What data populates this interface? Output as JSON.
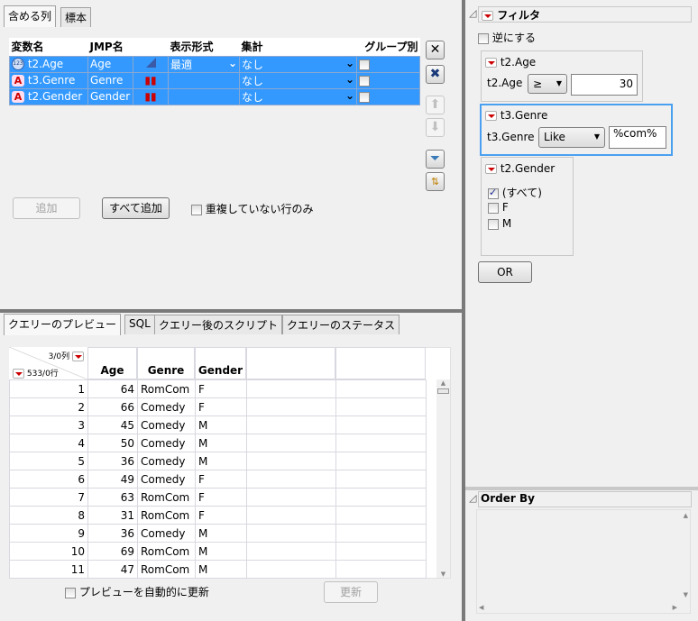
{
  "top_tabs": [
    "含める列",
    "標本"
  ],
  "columns_table": {
    "headers": [
      "変数名",
      "JMP名",
      "",
      "表示形式",
      "集計",
      "グループ別"
    ],
    "rows": [
      {
        "name": "t2.Age",
        "jmp": "Age",
        "type_icon": "numeric-icon",
        "model_icon": "continuous-icon",
        "format": "最適",
        "agg": "なし"
      },
      {
        "name": "t3.Genre",
        "jmp": "Genre",
        "type_icon": "character-icon",
        "model_icon": "nominal-icon",
        "format": "",
        "agg": "なし"
      },
      {
        "name": "t2.Gender",
        "jmp": "Gender",
        "type_icon": "character-icon",
        "model_icon": "nominal-icon",
        "format": "",
        "agg": "なし"
      }
    ]
  },
  "buttons": {
    "add": "追加",
    "add_all": "すべて追加",
    "distinct_only": "重複していない行のみ",
    "refresh": "更新",
    "auto_refresh": "プレビューを自動的に更新",
    "or": "OR"
  },
  "bottom_tabs": [
    "クエリーのプレビュー",
    "SQL",
    "クエリー後のスクリプト",
    "クエリーのステータス"
  ],
  "preview": {
    "cols_count": "3/0列",
    "rows_count": "533/0行",
    "headers": [
      "Age",
      "Genre",
      "Gender"
    ],
    "rows": [
      [
        1,
        64,
        "RomCom",
        "F"
      ],
      [
        2,
        66,
        "Comedy",
        "F"
      ],
      [
        3,
        45,
        "Comedy",
        "M"
      ],
      [
        4,
        50,
        "Comedy",
        "M"
      ],
      [
        5,
        36,
        "Comedy",
        "M"
      ],
      [
        6,
        49,
        "Comedy",
        "F"
      ],
      [
        7,
        63,
        "RomCom",
        "F"
      ],
      [
        8,
        31,
        "RomCom",
        "F"
      ],
      [
        9,
        36,
        "Comedy",
        "M"
      ],
      [
        10,
        69,
        "RomCom",
        "M"
      ],
      [
        11,
        47,
        "RomCom",
        "M"
      ]
    ]
  },
  "filter": {
    "title": "フィルタ",
    "invert": "逆にする",
    "age": {
      "title": "t2.Age",
      "label": "t2.Age",
      "op": "≥",
      "value": "30"
    },
    "genre": {
      "title": "t3.Genre",
      "label": "t3.Genre",
      "op": "Like",
      "value": "%com%"
    },
    "gender": {
      "title": "t2.Gender",
      "options": [
        {
          "label": "(すべて)",
          "checked": true
        },
        {
          "label": "F",
          "checked": false
        },
        {
          "label": "M",
          "checked": false
        }
      ]
    }
  },
  "order_by": {
    "title": "Order By"
  }
}
